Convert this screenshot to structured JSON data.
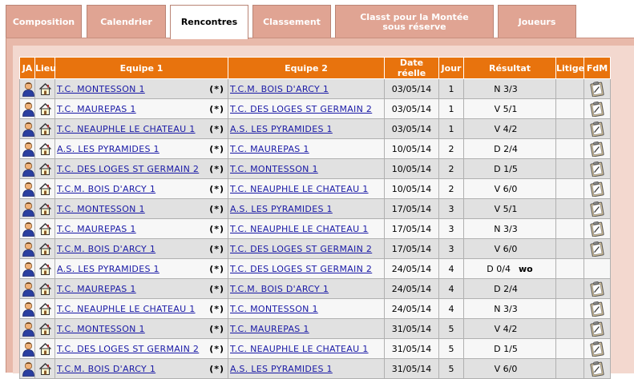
{
  "tabs": [
    {
      "label": "Composition",
      "active": false
    },
    {
      "label": "Calendrier",
      "active": false
    },
    {
      "label": "Rencontres",
      "active": true
    },
    {
      "label": "Classement",
      "active": false
    },
    {
      "label": "Classt pour la Montée sous réserve",
      "active": false
    },
    {
      "label": "Joueurs",
      "active": false
    }
  ],
  "table": {
    "headers": {
      "ja": "JA",
      "lieu": "Lieu",
      "equipe1": "Equipe 1",
      "equipe2": "Equipe 2",
      "date": "Date réelle",
      "jour": "Jour",
      "resultat": "Résultat",
      "litige": "Litige",
      "fdm": "FdM"
    },
    "rows": [
      {
        "equipe1": "T.C. MONTESSON 1",
        "marker": "(*)",
        "equipe2": "T.C.M. BOIS D'ARCY 1",
        "date": "03/05/14",
        "jour": "1",
        "resultat": "N 3/3",
        "wo": "",
        "fdm": true
      },
      {
        "equipe1": "T.C. MAUREPAS 1",
        "marker": "(*)",
        "equipe2": "T.C. DES LOGES ST GERMAIN 2",
        "date": "03/05/14",
        "jour": "1",
        "resultat": "V 5/1",
        "wo": "",
        "fdm": true
      },
      {
        "equipe1": "T.C. NEAUPHLE LE CHATEAU 1",
        "marker": "(*)",
        "equipe2": "A.S. LES PYRAMIDES 1",
        "date": "03/05/14",
        "jour": "1",
        "resultat": "V 4/2",
        "wo": "",
        "fdm": true
      },
      {
        "equipe1": "A.S. LES PYRAMIDES 1",
        "marker": "(*)",
        "equipe2": "T.C. MAUREPAS 1",
        "date": "10/05/14",
        "jour": "2",
        "resultat": "D 2/4",
        "wo": "",
        "fdm": true
      },
      {
        "equipe1": "T.C. DES LOGES ST GERMAIN 2",
        "marker": "(*)",
        "equipe2": "T.C. MONTESSON 1",
        "date": "10/05/14",
        "jour": "2",
        "resultat": "D 1/5",
        "wo": "",
        "fdm": true
      },
      {
        "equipe1": "T.C.M. BOIS D'ARCY 1",
        "marker": "(*)",
        "equipe2": "T.C. NEAUPHLE LE CHATEAU 1",
        "date": "10/05/14",
        "jour": "2",
        "resultat": "V 6/0",
        "wo": "",
        "fdm": true
      },
      {
        "equipe1": "T.C. MONTESSON 1",
        "marker": "(*)",
        "equipe2": "A.S. LES PYRAMIDES 1",
        "date": "17/05/14",
        "jour": "3",
        "resultat": "V 5/1",
        "wo": "",
        "fdm": true
      },
      {
        "equipe1": "T.C. MAUREPAS 1",
        "marker": "(*)",
        "equipe2": "T.C. NEAUPHLE LE CHATEAU 1",
        "date": "17/05/14",
        "jour": "3",
        "resultat": "N 3/3",
        "wo": "",
        "fdm": true
      },
      {
        "equipe1": "T.C.M. BOIS D'ARCY 1",
        "marker": "(*)",
        "equipe2": "T.C. DES LOGES ST GERMAIN 2",
        "date": "17/05/14",
        "jour": "3",
        "resultat": "V 6/0",
        "wo": "",
        "fdm": true
      },
      {
        "equipe1": "A.S. LES PYRAMIDES 1",
        "marker": "(*)",
        "equipe2": "T.C. DES LOGES ST GERMAIN 2",
        "date": "24/05/14",
        "jour": "4",
        "resultat": "D 0/4",
        "wo": "wo",
        "fdm": false
      },
      {
        "equipe1": "T.C. MAUREPAS 1",
        "marker": "(*)",
        "equipe2": "T.C.M. BOIS D'ARCY 1",
        "date": "24/05/14",
        "jour": "4",
        "resultat": "D 2/4",
        "wo": "",
        "fdm": true
      },
      {
        "equipe1": "T.C. NEAUPHLE LE CHATEAU 1",
        "marker": "(*)",
        "equipe2": "T.C. MONTESSON 1",
        "date": "24/05/14",
        "jour": "4",
        "resultat": "N 3/3",
        "wo": "",
        "fdm": true
      },
      {
        "equipe1": "T.C. MONTESSON 1",
        "marker": "(*)",
        "equipe2": "T.C. MAUREPAS 1",
        "date": "31/05/14",
        "jour": "5",
        "resultat": "V 4/2",
        "wo": "",
        "fdm": true
      },
      {
        "equipe1": "T.C. DES LOGES ST GERMAIN 2",
        "marker": "(*)",
        "equipe2": "T.C. NEAUPHLE LE CHATEAU 1",
        "date": "31/05/14",
        "jour": "5",
        "resultat": "D 1/5",
        "wo": "",
        "fdm": true
      },
      {
        "equipe1": "T.C.M. BOIS D'ARCY 1",
        "marker": "(*)",
        "equipe2": "A.S. LES PYRAMIDES 1",
        "date": "31/05/14",
        "jour": "5",
        "resultat": "V 6/0",
        "wo": "",
        "fdm": true
      }
    ]
  },
  "icons": {
    "ja": "person-icon",
    "lieu": "house-icon",
    "fdm": "clipboard-icon"
  },
  "colors": {
    "header_bg": "#e8730d",
    "tab_bg": "#e0a493",
    "panel_bg": "#e8b9aa",
    "link": "#1a1aa6",
    "row_odd": "#e1e1e1",
    "row_even": "#f7f7f7"
  }
}
